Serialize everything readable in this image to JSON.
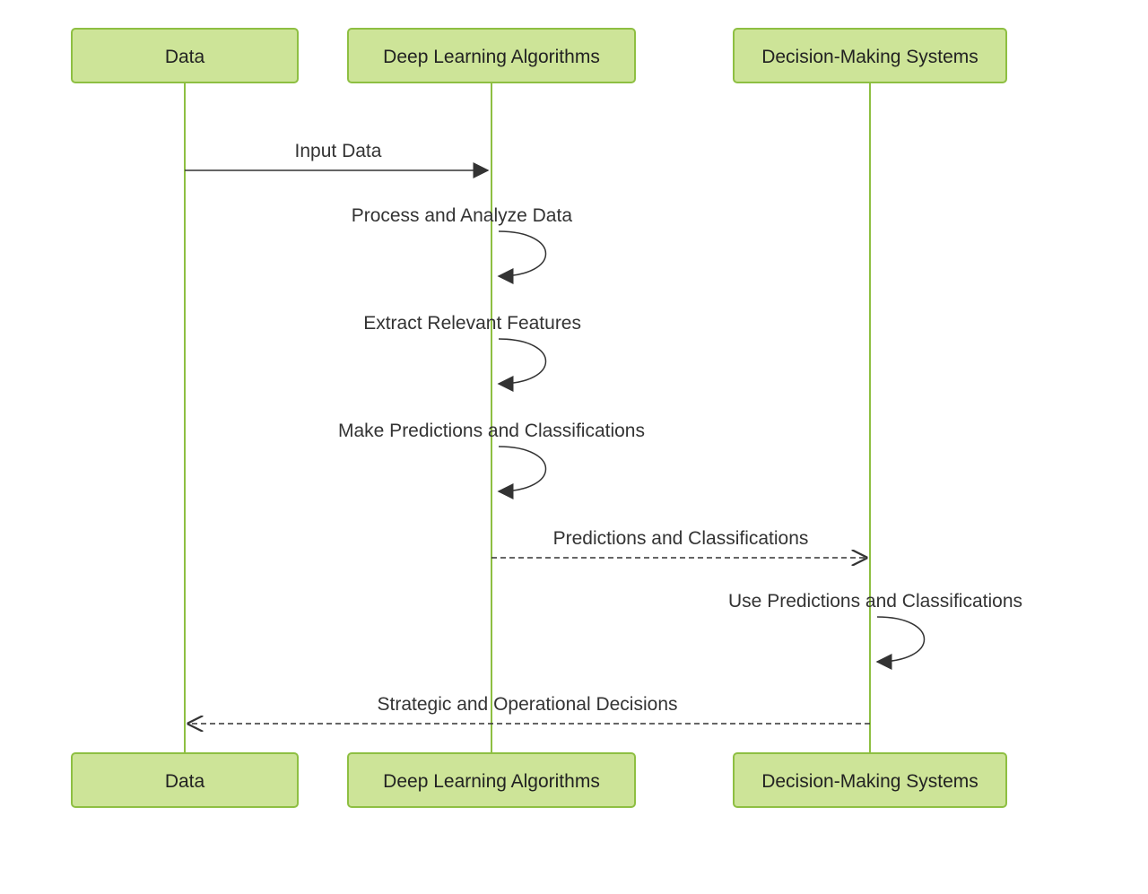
{
  "participants": {
    "data": "Data",
    "dla": "Deep Learning Algorithms",
    "dms": "Decision-Making Systems"
  },
  "messages": {
    "m1": "Input Data",
    "m2": "Process and Analyze Data",
    "m3": "Extract Relevant Features",
    "m4": "Make Predictions and Classifications",
    "m5": "Predictions and Classifications",
    "m6": "Use Predictions and Classifications",
    "m7": "Strategic and Operational Decisions"
  },
  "colors": {
    "participant_fill": "#cde498",
    "participant_stroke": "#8ebf42",
    "line": "#333333"
  }
}
